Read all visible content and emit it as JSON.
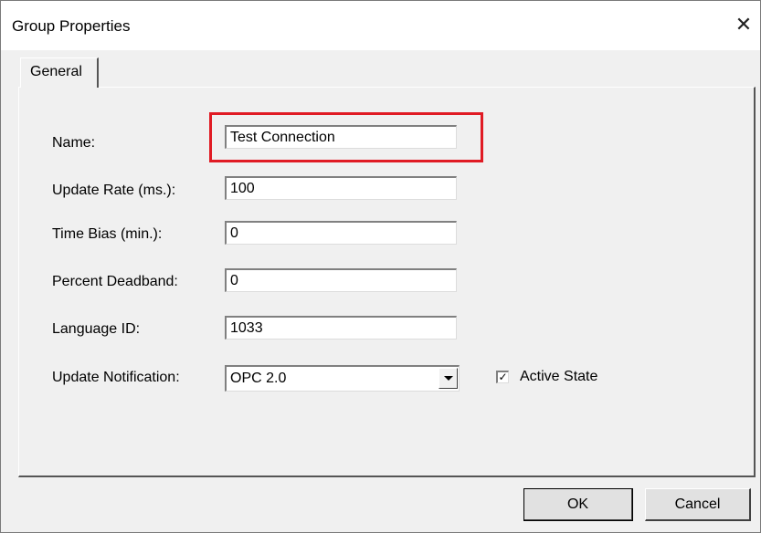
{
  "window": {
    "title": "Group Properties",
    "close_glyph": "✕"
  },
  "tabs": [
    {
      "label": "General"
    }
  ],
  "form": {
    "name_label": "Name:",
    "name_value": "Test Connection",
    "update_rate_label": "Update Rate (ms.):",
    "update_rate_value": "100",
    "time_bias_label": "Time Bias (min.):",
    "time_bias_value": "0",
    "deadband_label": "Percent Deadband:",
    "deadband_value": "0",
    "language_label": "Language ID:",
    "language_value": "1033",
    "notification_label": "Update Notification:",
    "notification_value": "OPC 2.0",
    "active_state_label": "Active State",
    "active_state_checked": true,
    "check_glyph": "✓"
  },
  "buttons": {
    "ok": "OK",
    "cancel": "Cancel"
  },
  "colors": {
    "highlight": "#e01b24",
    "dialog_bg": "#f0f0f0"
  }
}
